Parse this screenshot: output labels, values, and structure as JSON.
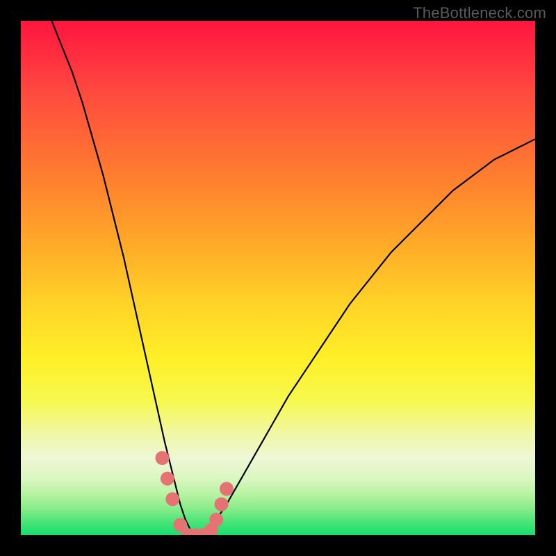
{
  "watermark_text": "TheBottleneck.com",
  "chart_data": {
    "type": "line",
    "title": "",
    "xlabel": "",
    "ylabel": "",
    "xlim": [
      0,
      100
    ],
    "ylim": [
      0,
      100
    ],
    "series": [
      {
        "name": "bottleneck-curve",
        "x": [
          0,
          2,
          4,
          6,
          8,
          10,
          12,
          14,
          16,
          18,
          20,
          22,
          24,
          26,
          28,
          30,
          31,
          32,
          33,
          34,
          35,
          36,
          38,
          40,
          44,
          48,
          52,
          56,
          60,
          64,
          68,
          72,
          76,
          80,
          84,
          88,
          92,
          96,
          100
        ],
        "values": [
          112,
          108,
          104,
          100,
          95,
          90,
          84,
          77,
          70,
          62,
          54,
          45,
          36,
          27,
          18,
          10,
          6,
          3,
          1,
          0,
          0,
          1,
          3,
          6,
          13,
          20,
          27,
          33,
          39,
          45,
          50,
          55,
          59,
          63,
          67,
          70,
          73,
          75,
          77
        ]
      }
    ],
    "markers": {
      "name": "highlighted-points",
      "color": "#e57373",
      "points": [
        {
          "x": 27.5,
          "y": 15
        },
        {
          "x": 28.5,
          "y": 11
        },
        {
          "x": 29.5,
          "y": 7
        },
        {
          "x": 31.0,
          "y": 2
        },
        {
          "x": 32.5,
          "y": 0
        },
        {
          "x": 34.0,
          "y": 0
        },
        {
          "x": 35.5,
          "y": 0
        },
        {
          "x": 37.0,
          "y": 1
        },
        {
          "x": 38.0,
          "y": 3
        },
        {
          "x": 39.0,
          "y": 6
        },
        {
          "x": 40.0,
          "y": 9
        }
      ]
    },
    "gradient_stops": [
      {
        "pos": 0,
        "color": "#ff153f"
      },
      {
        "pos": 50,
        "color": "#ffd627"
      },
      {
        "pos": 100,
        "color": "#18dd6f"
      }
    ]
  }
}
